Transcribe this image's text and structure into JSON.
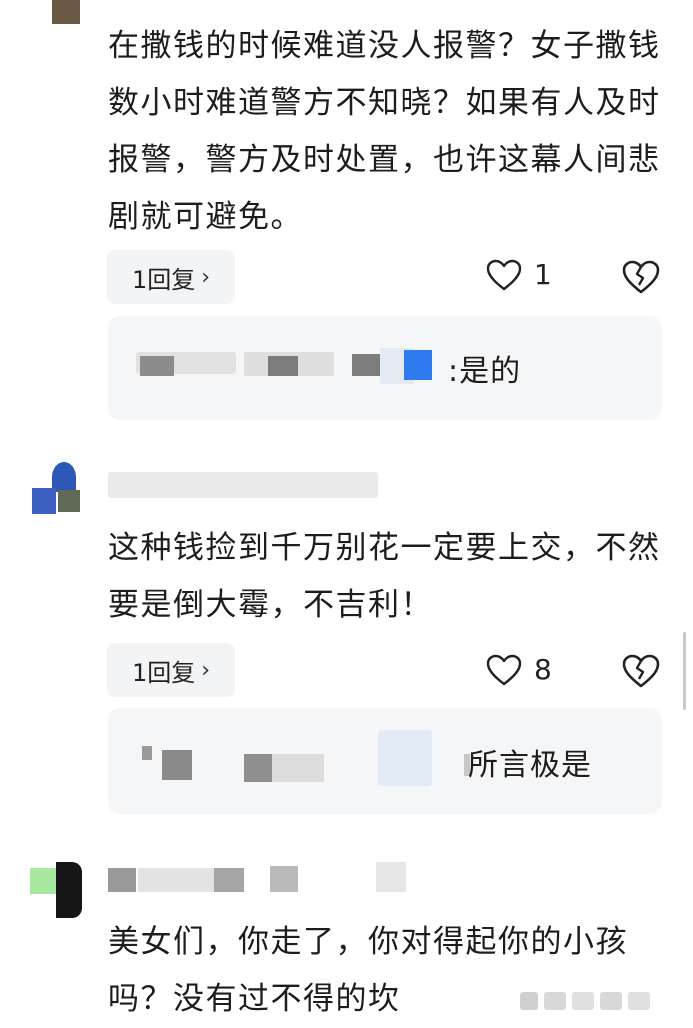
{
  "comments": [
    {
      "text": "在撒钱的时候难道没人报警？女子撒钱数小时难道警方不知晓？如果有人及时报警，警方及时处置，也许这幕人间悲剧就可避免。",
      "reply_label": "1回复",
      "likes": "1",
      "subreply": {
        "text": ":是的"
      }
    },
    {
      "text": "这种钱捡到千万别花一定要上交，不然要是倒大霉，不吉利！",
      "reply_label": "1回复",
      "likes": "8",
      "subreply": {
        "text": "所言极是"
      }
    },
    {
      "text": "美女们，你走了，你对得起你的小孩吗？没有过不得的坎"
    }
  ],
  "icons": {
    "like": "heart-outline-icon",
    "dislike": "broken-heart-icon",
    "chevron": "chevron-right-icon"
  },
  "colors": {
    "sub_box_bg": "#f5f6f8",
    "reply_bg": "#f3f4f6",
    "text": "#1d1d1d"
  }
}
